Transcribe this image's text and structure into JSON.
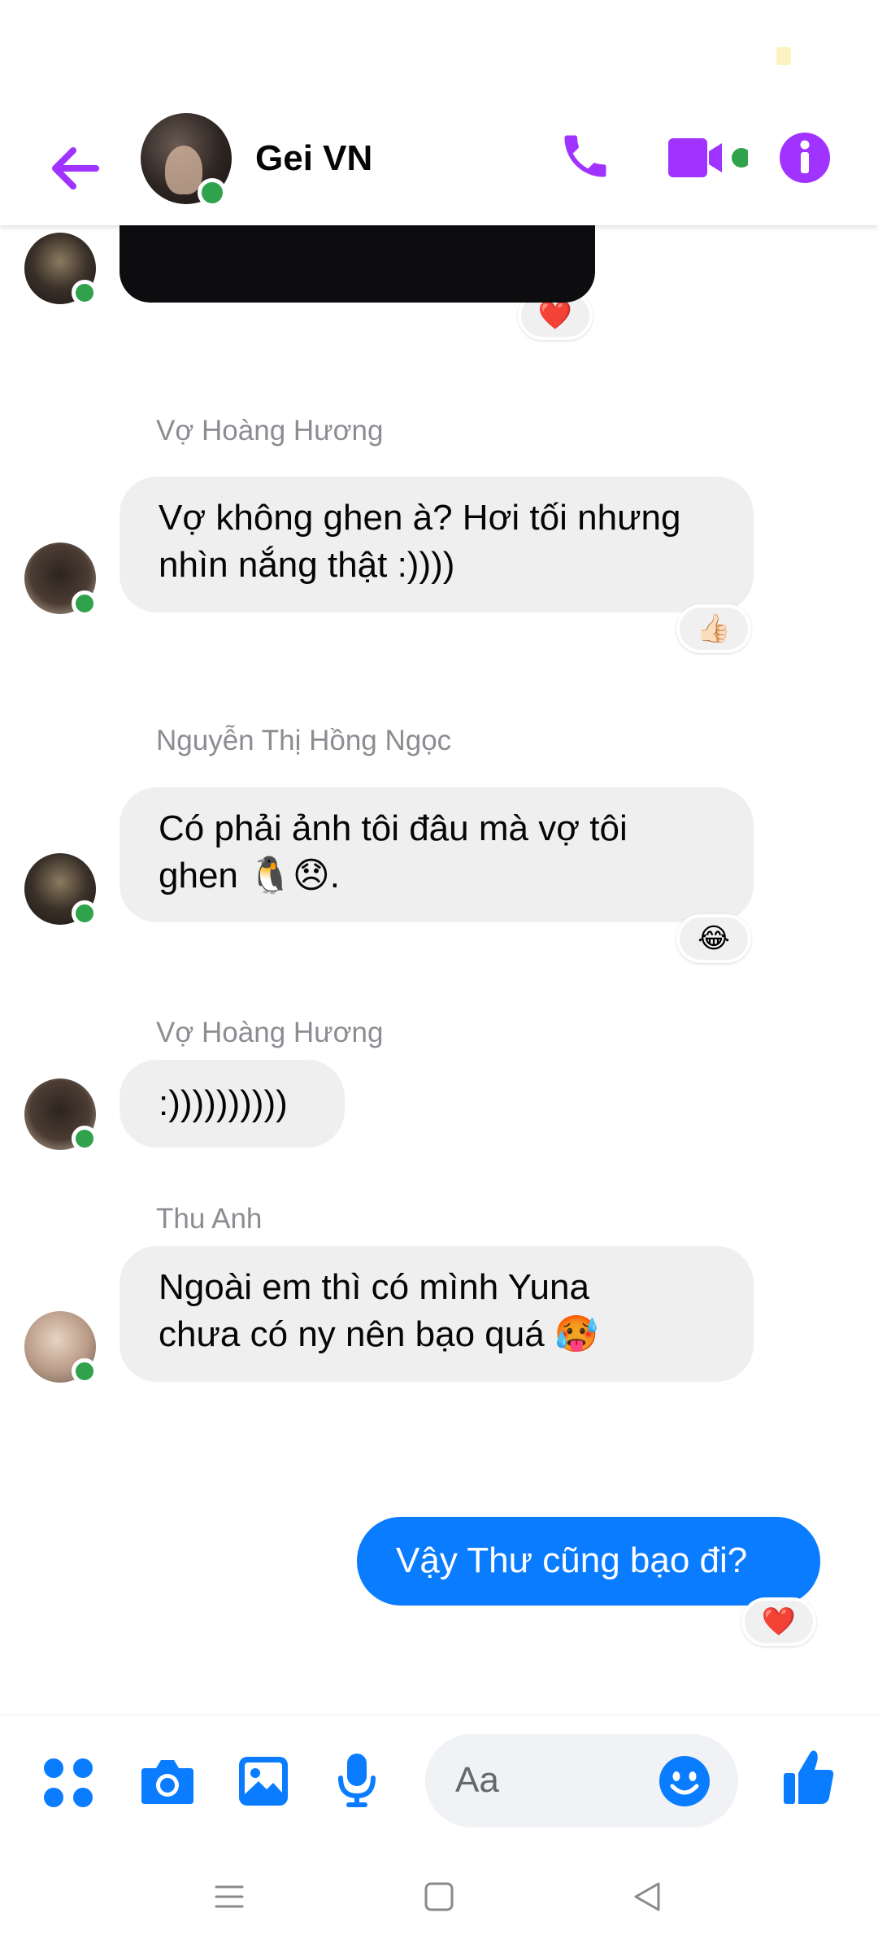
{
  "header": {
    "title": "Gei VN",
    "icons": [
      "back-arrow-icon",
      "phone-icon",
      "video-camera-icon",
      "info-icon"
    ],
    "accent_color": "#a033ff"
  },
  "messages": [
    {
      "type": "media",
      "reaction": "❤️",
      "avatar": "avatar"
    },
    {
      "sender": "Vợ Hoàng Hương",
      "line1": "Vợ không ghen à? Hơi tối nhưng",
      "line2": "nhìn nắng thật :))))",
      "reaction": "👍🏻"
    },
    {
      "sender": "Nguyễn Thị Hồng Ngọc",
      "line1": "Có phải ảnh tôi đâu mà vợ tôi",
      "line2": "ghen 🐧😞.",
      "reaction": "😂"
    },
    {
      "sender": "Vợ Hoàng Hương",
      "line1": ":))))))))))"
    },
    {
      "sender": "Thu Anh",
      "line1": "Ngoài em thì có mình Yuna",
      "line2": "chưa có ny nên bạo quá 🥵"
    },
    {
      "outgoing": true,
      "line1": "Vậy Thư cũng bạo đi?",
      "reaction": "❤️"
    }
  ],
  "composer": {
    "placeholder": "Aa",
    "icons": [
      "menu-dots-icon",
      "camera-icon",
      "gallery-icon",
      "microphone-icon",
      "emoji-icon",
      "thumbs-up-icon"
    ],
    "color": "#0a7cff"
  },
  "navbar": {
    "icons": [
      "recent-apps-icon",
      "home-icon",
      "back-icon"
    ]
  }
}
